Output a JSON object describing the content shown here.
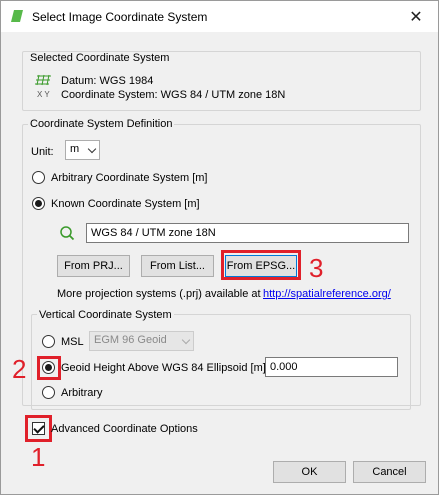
{
  "window": {
    "title": "Select Image Coordinate System",
    "close_glyph": "✕"
  },
  "selected_cs": {
    "heading": "Selected Coordinate System",
    "datum": "Datum: WGS 1984",
    "coordinate_system": "Coordinate System: WGS 84 / UTM zone 18N",
    "icon_caption": "X Y"
  },
  "definition": {
    "heading": "Coordinate System Definition",
    "unit_label": "Unit:",
    "unit_value": "m",
    "arbitrary_label": "Arbitrary Coordinate System [m]",
    "known_label": "Known Coordinate System [m]",
    "search_value": "WGS 84 / UTM zone 18N",
    "from_prj": "From PRJ...",
    "from_list": "From List...",
    "from_epsg": "From EPSG...",
    "more_text": "More projection systems (.prj) available at",
    "more_link": "http://spatialreference.org/"
  },
  "vertical": {
    "heading": "Vertical Coordinate System",
    "msl_label": "MSL",
    "msl_combo": "EGM 96 Geoid",
    "geoid_label": "Geoid Height Above WGS 84 Ellipsoid [m]",
    "geoid_value": "0.000",
    "arbitrary_label": "Arbitrary"
  },
  "advanced_label": "Advanced Coordinate Options",
  "buttons": {
    "ok": "OK",
    "cancel": "Cancel"
  },
  "annotations": {
    "n1": "1",
    "n2": "2",
    "n3": "3"
  },
  "colors": {
    "annotation_red": "#e0202a",
    "link_blue": "#0000ee",
    "icon_green": "#3a9a2a"
  }
}
